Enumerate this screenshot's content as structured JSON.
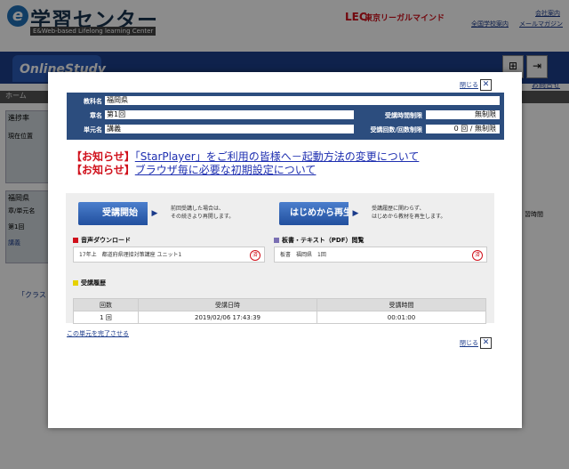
{
  "app": {
    "title": "学習センター",
    "subtitle": "E&Web-based Lifelong learning Center",
    "lec_mark": "LEC",
    "lec_name": "東京リーガルマインド",
    "link_company": "会社案内",
    "link_schools": "全国学校案内",
    "link_mail": "メールマガジン",
    "nav_brand": "OnlineStudy",
    "logout": "ログアウト",
    "inquiry": "お問合せ",
    "breadcrumb": "ホーム",
    "side_progress": "進捗率",
    "side_current": "現在位置",
    "side_pref": "福岡県",
    "side_col": "章/単元名",
    "side_time": "習時間",
    "side_chapter": "第1回",
    "side_lecture": "講義",
    "side_class": "「クラス"
  },
  "modal": {
    "close_label": "閉じる",
    "close_icon": "close-x-icon",
    "info": {
      "subject_label": "教科名",
      "subject_value": "福岡県",
      "chapter_label": "章名",
      "chapter_value": "第1回",
      "unit_label": "単元名",
      "unit_value": "講義",
      "time_limit_label": "受講時間制限",
      "time_limit_value": "無制限",
      "count_limit_label": "受講回数/回数制限",
      "count_limit_value": "0 回 / 無制限"
    },
    "notices": [
      {
        "tag": "【お知らせ】",
        "text": "「StarPlayer」をご利用の皆様へ－起動方法の変更について"
      },
      {
        "tag": "【お知らせ】",
        "text": "ブラウザ毎に必要な初期設定について"
      }
    ],
    "start_button": "受講開始",
    "start_desc_1": "前回受講した場合は、",
    "start_desc_2": "その続きより再開します。",
    "restart_button": "はじめから再生",
    "restart_desc_1": "受講履歴に関わらず、",
    "restart_desc_2": "はじめから教材を再生します。",
    "audio_heading": "音声ダウンロード",
    "audio_item": "17年上　都道府県理接対策講座 ユニット1",
    "pdf_heading": "板書・テキスト（PDF）閲覧",
    "pdf_item": "板書　福岡県　1回",
    "done_badge": "済",
    "history_heading": "受講履歴",
    "history_cols": [
      "回数",
      "受講日時",
      "受講時間"
    ],
    "history_rows": [
      [
        "1 回",
        "2019/02/06 17:43:39",
        "00:01:00"
      ]
    ],
    "finish_link": "この単元を完了させる",
    "accent_color": "#2c4d7e",
    "notice_color": "#d0101b"
  }
}
